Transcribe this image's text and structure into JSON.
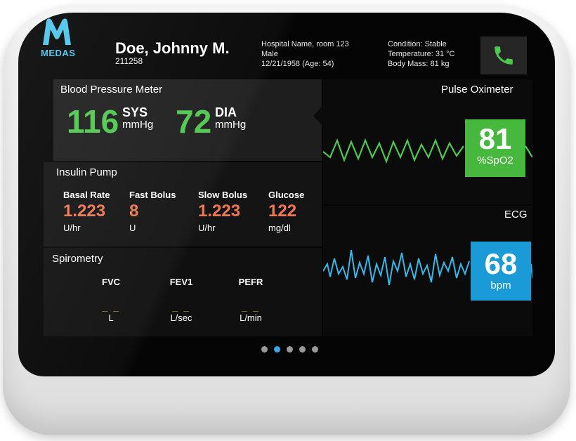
{
  "brand": {
    "name": "MEDAS"
  },
  "patient": {
    "name": "Doe, Johnny M.",
    "id": "211258",
    "location": "Hospital Name, room 123",
    "sex": "Male",
    "dob": "12/21/1958 (Age: 54)",
    "condition": "Condition: Stable",
    "temperature": "Temperature: 31 °C",
    "body_mass": "Body Mass: 81 kg"
  },
  "blood_pressure": {
    "title": "Blood Pressure Meter",
    "sys_value": "116",
    "sys_label": "SYS",
    "sys_unit": "mmHg",
    "dia_value": "72",
    "dia_label": "DIA",
    "dia_unit": "mmHg"
  },
  "insulin": {
    "title": "Insulin Pump",
    "items": [
      {
        "label": "Basal Rate",
        "value": "1.223",
        "unit": "U/hr"
      },
      {
        "label": "Fast Bolus",
        "value": "8",
        "unit": "U"
      },
      {
        "label": "Slow Bolus",
        "value": "1.223",
        "unit": "U/hr"
      },
      {
        "label": "Glucose",
        "value": "122",
        "unit": "mg/dl"
      }
    ]
  },
  "spirometry": {
    "title": "Spirometry",
    "items": [
      {
        "label": "FVC",
        "value": "_ _",
        "unit": "L"
      },
      {
        "label": "FEV1",
        "value": "_ _",
        "unit": "L/sec"
      },
      {
        "label": "PEFR",
        "value": "_ _",
        "unit": "L/min"
      }
    ]
  },
  "pulse_oximeter": {
    "title": "Pulse Oximeter",
    "value": "81",
    "unit": "%SpO2"
  },
  "ecg": {
    "title": "ECG",
    "value": "68",
    "unit": "bpm"
  },
  "pagination": {
    "count": 5,
    "active_index": 1
  },
  "colors": {
    "accent_green": "#4ec84e",
    "accent_blue": "#1a9ad6",
    "value_orange": "#f07850",
    "ecg_wave": "#38b8e8",
    "logo_blue": "#4cc4ea"
  },
  "icons": {
    "call": "phone-icon",
    "logo": "medas-logo-icon"
  }
}
